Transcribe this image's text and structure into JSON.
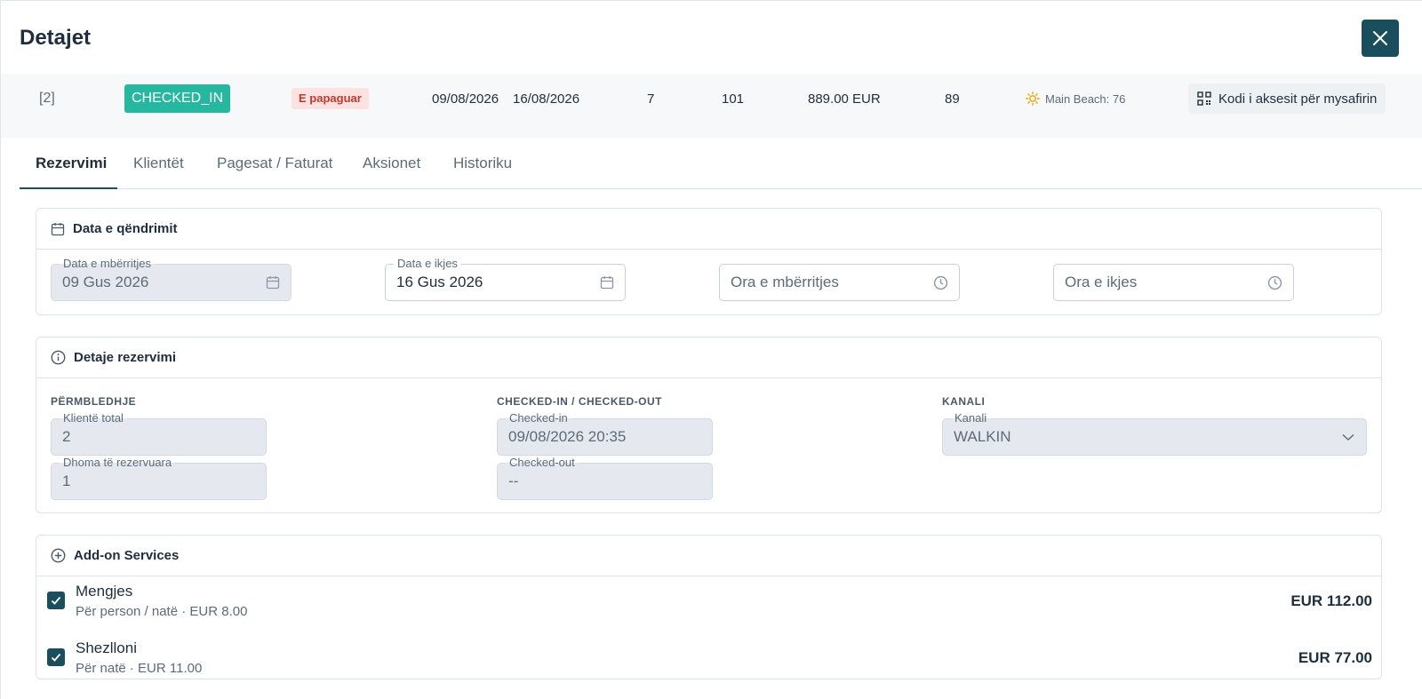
{
  "header": {
    "title": "Detajet"
  },
  "summary": {
    "guests_count": "[2]",
    "status": "CHECKED_IN",
    "payment_status": "E papaguar",
    "date_from": "09/08/2026",
    "date_to": "16/08/2026",
    "nights": "7",
    "room": "101",
    "total": "889.00 EUR",
    "id": "89",
    "beach": "Main Beach: 76",
    "access_button": "Kodi i aksesit për mysafirin"
  },
  "tabs": [
    {
      "label": "Rezervimi"
    },
    {
      "label": "Klientët"
    },
    {
      "label": "Pagesat / Faturat"
    },
    {
      "label": "Aksionet"
    },
    {
      "label": "Historiku"
    }
  ],
  "stay": {
    "title": "Data e qëndrimit",
    "arrival_label": "Data e mbërritjes",
    "arrival_value": "09 Gus 2026",
    "departure_label": "Data e ikjes",
    "departure_value": "16 Gus 2026",
    "arrival_time_placeholder": "Ora e mbërritjes",
    "departure_time_placeholder": "Ora e ikjes"
  },
  "details": {
    "title": "Detaje rezervimi",
    "summary_heading": "PËRMBLEDHJE",
    "total_clients_label": "Klientë total",
    "total_clients_value": "2",
    "rooms_label": "Dhoma të rezervuara",
    "rooms_value": "1",
    "checkin_heading": "CHECKED-IN / CHECKED-OUT",
    "checkin_label": "Checked-in",
    "checkin_value": "09/08/2026 20:35",
    "checkout_label": "Checked-out",
    "checkout_value": "--",
    "channel_heading": "KANALI",
    "channel_label": "Kanali",
    "channel_value": "WALKIN"
  },
  "addons": {
    "title": "Add-on Services",
    "items": [
      {
        "name": "Mengjes",
        "sub": "Për person / natë · EUR 8.00",
        "price": "EUR 112.00",
        "checked": true
      },
      {
        "name": "Shezlloni",
        "sub": "Për natë · EUR 11.00",
        "price": "EUR 77.00",
        "checked": true
      }
    ]
  },
  "colors": {
    "accent": "#1b4e5c",
    "status": "#26b7a1",
    "unpaid_bg": "#fde2e1",
    "unpaid_text": "#c0392b",
    "sun": "#f0a500"
  }
}
